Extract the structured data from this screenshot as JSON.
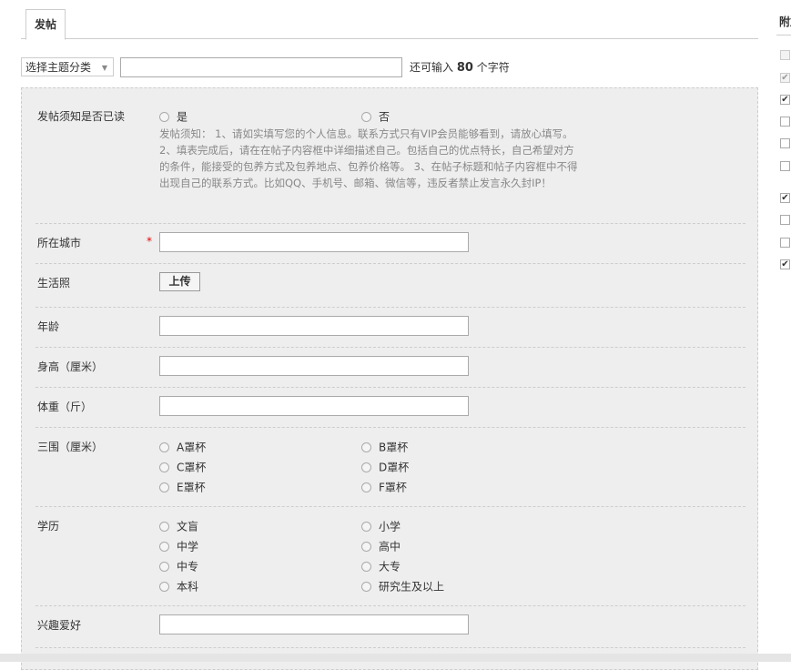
{
  "tabs": {
    "post": "发帖"
  },
  "subject": {
    "category_selected": "选择主题分类",
    "remaining_prefix": "还可输入",
    "remaining_count": "80",
    "remaining_suffix": "个字符"
  },
  "form": {
    "notice": {
      "label": "发帖须知是否已读",
      "options": [
        "是",
        "否"
      ],
      "text": "发帖须知： 1、请如实填写您的个人信息。联系方式只有VIP会员能够看到，请放心填写。 2、填表完成后，请在在帖子内容框中详细描述自己。包括自己的优点特长，自己希望对方的条件，能接受的包养方式及包养地点、包养价格等。 3、在帖子标题和帖子内容框中不得出现自己的联系方式。比如QQ、手机号、邮箱、微信等，违反者禁止发言永久封IP！"
    },
    "city": {
      "label": "所在城市",
      "required_mark": "*"
    },
    "photo": {
      "label": "生活照",
      "upload_button": "上传"
    },
    "age": {
      "label": "年龄"
    },
    "height": {
      "label": "身高（厘米）"
    },
    "weight": {
      "label": "体重（斤）"
    },
    "measurements": {
      "label": "三围（厘米）",
      "options": [
        "A罩杯",
        "B罩杯",
        "C罩杯",
        "D罩杯",
        "E罩杯",
        "F罩杯"
      ]
    },
    "education": {
      "label": "学历",
      "options": [
        "文盲",
        "小学",
        "中学",
        "高中",
        "中专",
        "大专",
        "本科",
        "研究生及以上"
      ]
    },
    "hobbies": {
      "label": "兴趣爱好"
    }
  },
  "sidebar": {
    "title": "附加选项",
    "checkboxes": [
      {
        "checked": false,
        "disabled": true
      },
      {
        "checked": true,
        "disabled": true
      },
      {
        "checked": true,
        "disabled": false
      },
      {
        "checked": false,
        "disabled": false
      },
      {
        "checked": false,
        "disabled": false
      },
      {
        "checked": false,
        "disabled": false
      },
      {
        "checked": true,
        "disabled": false
      },
      {
        "checked": false,
        "disabled": false
      },
      {
        "checked": false,
        "disabled": false
      },
      {
        "checked": true,
        "disabled": false
      }
    ]
  },
  "icons": {
    "dropdown": "chevron-down-icon",
    "check": "check-icon"
  }
}
